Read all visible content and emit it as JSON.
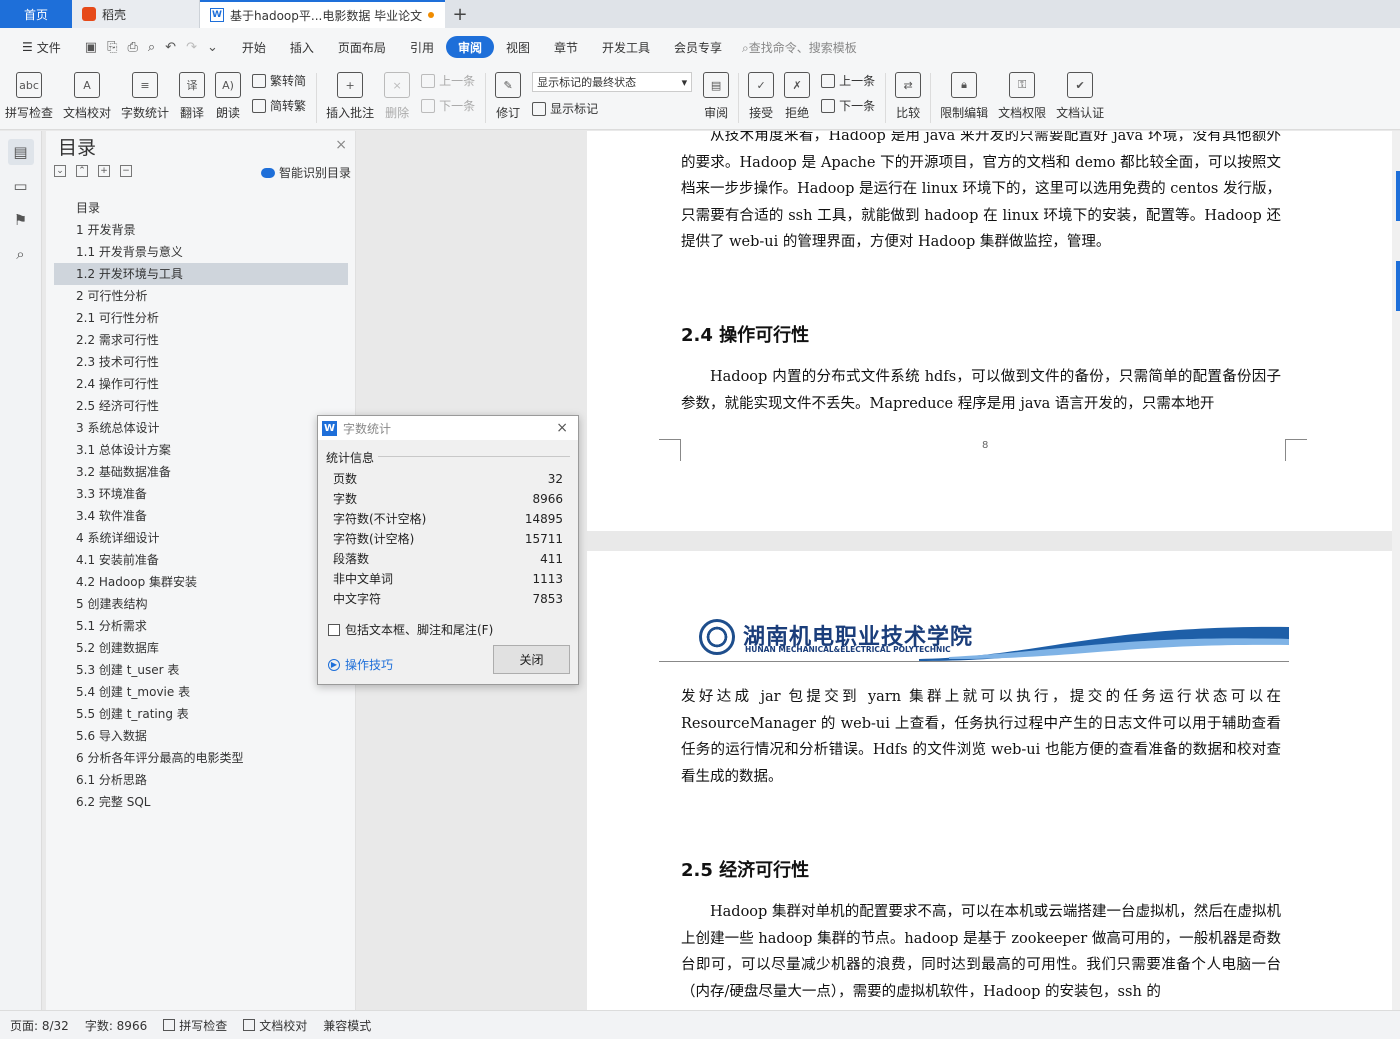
{
  "tabs": {
    "home": "首页",
    "wps": "稻壳",
    "doc": "基于hadoop平...电影数据 毕业论文"
  },
  "menu": {
    "file": "文件",
    "items": [
      "开始",
      "插入",
      "页面布局",
      "引用",
      "审阅",
      "视图",
      "章节",
      "开发工具",
      "会员专享"
    ],
    "active_index": 4,
    "search": "查找命令、搜索模板"
  },
  "ribbon": {
    "spell": "拼写检查",
    "proof": "文档校对",
    "wordcount": "字数统计",
    "translate": "翻译",
    "read": "朗读",
    "trad": "繁转简",
    "simp": "简转繁",
    "insert_comment": "插入批注",
    "delete": "删除",
    "prev": "上一条",
    "next": "下一条",
    "revise": "修订",
    "markup_select": "显示标记的最终状态",
    "show_markup": "显示标记",
    "review": "审阅",
    "accept": "接受",
    "reject": "拒绝",
    "prev2": "上一条",
    "next2": "下一条",
    "compare": "比较",
    "restrict": "限制编辑",
    "rights": "文档权限",
    "certify": "文档认证"
  },
  "nav": {
    "title": "目录",
    "ai": "智能识别目录",
    "toc": [
      "目录",
      "1  开发背景",
      "1.1 开发背景与意义",
      "1.2  开发环境与工具",
      "2  可行性分析",
      " 2.1  可行性分析",
      "2.2  需求可行性",
      "2.3  技术可行性",
      "2.4  操作可行性",
      "2.5 经济可行性",
      "3  系统总体设计",
      "3.1  总体设计方案",
      "3.2  基础数据准备",
      "3.3  环境准备",
      "3.4  软件准备",
      "4  系统详细设计",
      "4.1  安装前准备",
      "4.2 Hadoop 集群安装",
      "5  创建表结构",
      "5.1  分析需求",
      "5.2  创建数据库",
      "5.3  创建 t_user 表",
      "5.4  创建 t_movie 表",
      "5.5  创建 t_rating 表",
      "5.6  导入数据",
      "6  分析各年评分最高的电影类型",
      "6.1  分析思路",
      "6.2  完整 SQL"
    ],
    "selected_index": 3
  },
  "document": {
    "page1_para1": "从技术角度来看，Hadoop 是用 java 来开发的只需要配置好 java 环境，没有其他额外的要求。Hadoop 是 Apache 下的开源项目，官方的文档和 demo 都比较全面，可以按照文档来一步步操作。Hadoop 是运行在 linux 环境下的，这里可以选用免费的 centos 发行版，只需要有合适的 ssh 工具，就能做到 hadoop 在 linux 环境下的安装，配置等。Hadoop 还提供了 web-ui 的管理界面，方便对 Hadoop 集群做监控，管理。",
    "heading_24": "2.4  操作可行性",
    "page1_para2": "Hadoop 内置的分布式文件系统 hdfs，可以做到文件的备份，只需简单的配置备份因子参数，就能实现文件不丢失。Mapreduce 程序是用 java 语言开发的，只需本地开",
    "page_number": "8",
    "logo_cn": "湖南机电职业技术学院",
    "logo_en": "HUNAN MECHANICAL&ELECTRICAL POLYTECHNIC",
    "page2_para1": "发好达成 jar 包提交到 yarn 集群上就可以执行，提交的任务运行状态可以在 ResourceManager 的 web-ui 上查看，任务执行过程中产生的日志文件可以用于辅助查看任务的运行情况和分析错误。Hdfs 的文件浏览 web-ui 也能方便的查看准备的数据和校对查看生成的数据。",
    "heading_25": "2.5 经济可行性",
    "page2_para2": "Hadoop 集群对单机的配置要求不高，可以在本机或云端搭建一台虚拟机，然后在虚拟机上创建一些 hadoop 集群的节点。hadoop 是基于 zookeeper 做高可用的，一般机器是奇数台即可，可以尽量减少机器的浪费，同时达到最高的可用性。我们只需要准备个人电脑一台（内存/硬盘尽量大一点），需要的虚拟机软件，Hadoop 的安装包，ssh 的"
  },
  "dialog": {
    "title": "字数统计",
    "section": "统计信息",
    "rows": [
      {
        "label": "页数",
        "value": "32"
      },
      {
        "label": "字数",
        "value": "8966"
      },
      {
        "label": "字符数(不计空格)",
        "value": "14895"
      },
      {
        "label": "字符数(计空格)",
        "value": "15711"
      },
      {
        "label": "段落数",
        "value": "411"
      },
      {
        "label": "非中文单词",
        "value": "1113"
      },
      {
        "label": "中文字符",
        "value": "7853"
      }
    ],
    "checkbox": "包括文本框、脚注和尾注(F)",
    "tips": "操作技巧",
    "close": "关闭"
  },
  "status": {
    "page": "页面: 8/32",
    "words": "字数: 8966",
    "spell": "拼写检查",
    "proof": "文档校对",
    "compat": "兼容模式"
  },
  "colors": {
    "accent": "#1e6fd9",
    "logo": "#1a3d7a"
  }
}
